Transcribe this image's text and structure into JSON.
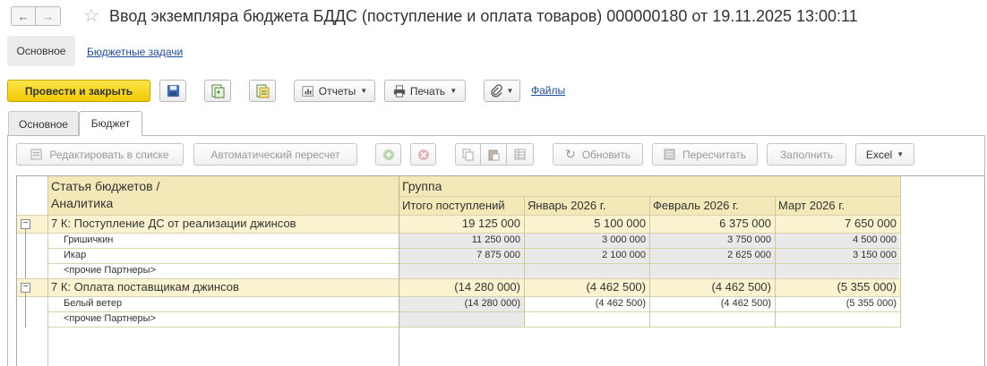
{
  "window": {
    "title": "Ввод экземпляра бюджета БДДС (поступление и оплата товаров) 000000180 от 19.11.2025 13:00:11",
    "back_glyph": "←",
    "forward_glyph": "→",
    "star_glyph": "☆"
  },
  "sections": {
    "active": "Основное",
    "link": "Бюджетные задачи"
  },
  "commandbar": {
    "post_close": "Провести и закрыть",
    "reports": "Отчеты",
    "print": "Печать",
    "files": "Файлы"
  },
  "tabs": [
    {
      "label": "Основное"
    },
    {
      "label": "Бюджет"
    }
  ],
  "grid_toolbar": {
    "edit_in_list": "Редактировать в списке",
    "auto_recalc": "Автоматический пересчет",
    "refresh": "Обновить",
    "recalc": "Пересчитать",
    "fill": "Заполнить",
    "excel": "Excel"
  },
  "table": {
    "header_item_line1": "Статья бюджетов /",
    "header_item_line2": "Аналитика",
    "header_group": "Группа",
    "columns": [
      "Итого поступлений",
      "Январь 2026 г.",
      "Февраль 2026 г.",
      "Март 2026 г."
    ],
    "rows": [
      {
        "label": "7 К: Поступление ДС от реализации джинсов",
        "values": [
          "19 125 000",
          "5 100 000",
          "6 375 000",
          "7 650 000"
        ]
      },
      {
        "label": "Гришичкин",
        "values": [
          "11 250 000",
          "3 000 000",
          "3 750 000",
          "4 500 000"
        ]
      },
      {
        "label": "Икар",
        "values": [
          "7 875 000",
          "2 100 000",
          "2 625 000",
          "3 150 000"
        ]
      },
      {
        "label": "<прочие Партнеры>",
        "values": [
          "",
          "",
          "",
          ""
        ]
      },
      {
        "label": "7 К: Оплата поставщикам джинсов",
        "values": [
          "(14 280 000)",
          "(4 462 500)",
          "(4 462 500)",
          "(5 355 000)"
        ]
      },
      {
        "label": "Белый ветер",
        "values": [
          "(14 280 000)",
          "(4 462 500)",
          "(4 462 500)",
          "(5 355 000)"
        ]
      },
      {
        "label": "<прочие Партнеры>",
        "values": [
          "",
          "",
          "",
          ""
        ]
      }
    ],
    "toggle_glyph": "−"
  }
}
